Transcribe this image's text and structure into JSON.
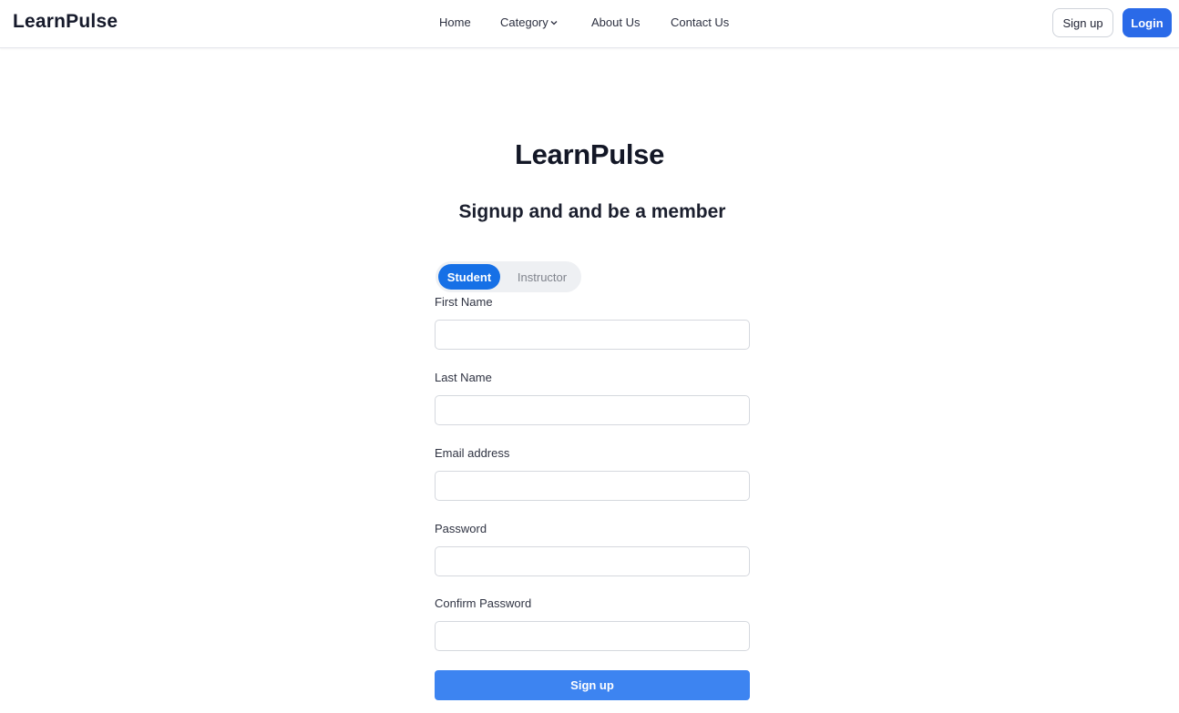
{
  "navbar": {
    "brand": "LearnPulse",
    "links": {
      "home": "Home",
      "category": "Category",
      "about": "About Us",
      "contact": "Contact Us"
    },
    "signup_label": "Sign up",
    "login_label": "Login"
  },
  "form": {
    "logo": "LearnPulse",
    "subtitle": "Signup and and be a member",
    "roles": {
      "student": "Student",
      "instructor": "Instructor",
      "selected": "Student"
    },
    "fields": {
      "first_name": {
        "label": "First Name",
        "value": ""
      },
      "last_name": {
        "label": "Last Name",
        "value": ""
      },
      "email": {
        "label": "Email address",
        "value": ""
      },
      "password": {
        "label": "Password",
        "value": ""
      },
      "confirm_password": {
        "label": "Confirm Password",
        "value": ""
      }
    },
    "submit_label": "Sign up"
  },
  "colors": {
    "primary": "#2a6ae8",
    "toggle_active": "#1670e6",
    "submit": "#3d84f1"
  },
  "icons": {
    "category_dropdown": "chevron-down-icon"
  }
}
